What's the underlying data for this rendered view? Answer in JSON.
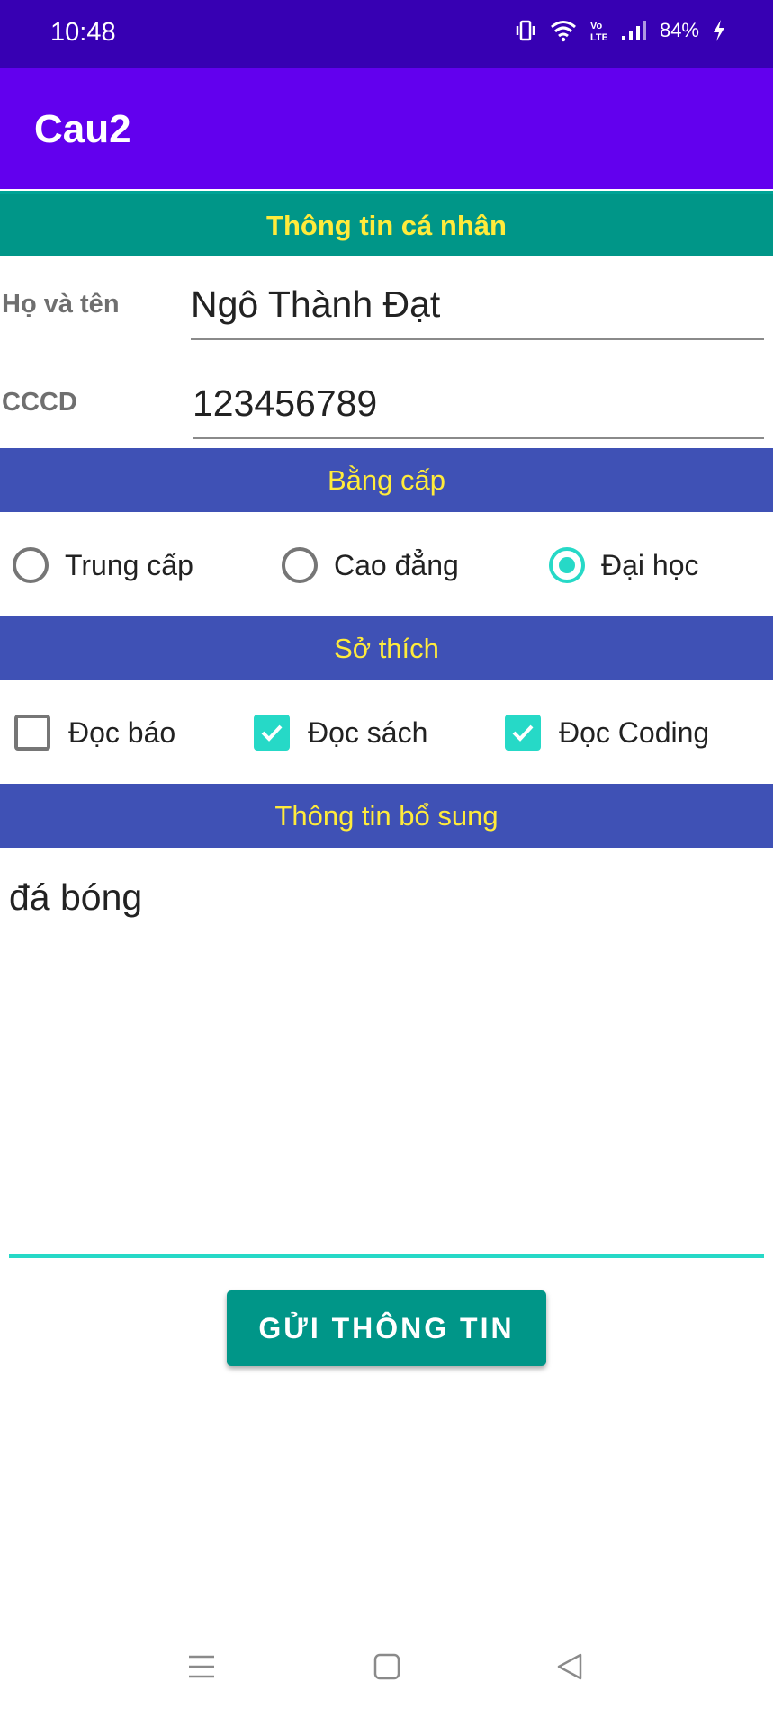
{
  "status_bar": {
    "time": "10:48",
    "battery": "84%",
    "icons": [
      "vibrate-icon",
      "wifi-icon",
      "volte-icon",
      "signal-icon",
      "charging-icon"
    ]
  },
  "app_bar": {
    "title": "Cau2"
  },
  "personal_section": {
    "header": "Thông tin cá nhân",
    "name_label": "Họ và tên",
    "name_value": "Ngô Thành Đạt",
    "cccd_label": "CCCD",
    "cccd_value": "123456789"
  },
  "degree_section": {
    "header": "Bằng cấp",
    "options": [
      {
        "label": "Trung cấp",
        "selected": false
      },
      {
        "label": "Cao đẳng",
        "selected": false
      },
      {
        "label": "Đại học",
        "selected": true
      }
    ]
  },
  "hobby_section": {
    "header": "Sở thích",
    "options": [
      {
        "label": "Đọc báo",
        "checked": false
      },
      {
        "label": "Đọc sách",
        "checked": true
      },
      {
        "label": "Đọc Coding",
        "checked": true
      }
    ]
  },
  "extra_section": {
    "header": "Thông tin bổ sung",
    "value": "đá bóng"
  },
  "submit_label": "GỬI THÔNG TIN",
  "colors": {
    "status_bar": "#3700b3",
    "app_bar": "#6200ee",
    "personal_header": "#009688",
    "section_header": "#3f51b5",
    "header_text": "#ffeb3b",
    "accent": "#26d9c7",
    "button": "#009688"
  }
}
